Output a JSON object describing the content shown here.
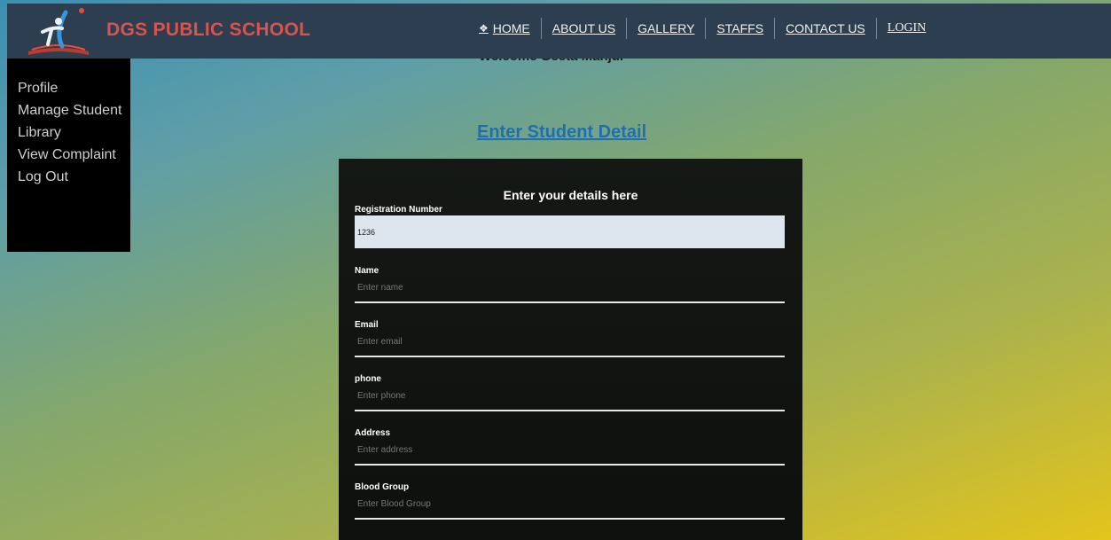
{
  "header": {
    "brand": "DGS PUBLIC SCHOOL",
    "nav": [
      {
        "label": "HOME",
        "icon": "home-icon"
      },
      {
        "label": "ABOUT US"
      },
      {
        "label": "GALLERY"
      },
      {
        "label": "STAFFS"
      },
      {
        "label": "CONTACT US"
      },
      {
        "label": "LOGIN"
      }
    ]
  },
  "welcome": "Welcome Geeta Manju.",
  "sidebar": {
    "items": [
      {
        "label": "Profile"
      },
      {
        "label": "Manage Student"
      },
      {
        "label": "Library"
      },
      {
        "label": "View Complaint"
      },
      {
        "label": "Log Out"
      }
    ]
  },
  "main": {
    "title": "Enter Student Detail"
  },
  "form": {
    "title": "Enter your details here",
    "registration": {
      "label": "Registration Number",
      "value": "1236"
    },
    "fields": [
      {
        "label": "Name",
        "placeholder": "Enter name"
      },
      {
        "label": "Email",
        "placeholder": "Enter email"
      },
      {
        "label": "phone",
        "placeholder": "Enter phone"
      },
      {
        "label": "Address",
        "placeholder": "Enter address"
      },
      {
        "label": "Blood Group",
        "placeholder": "Enter Blood Group"
      }
    ]
  },
  "colors": {
    "topbar": "#2c3e50",
    "brand": "#d9534f",
    "title_link": "#1f6fb0",
    "card": "#121412"
  }
}
